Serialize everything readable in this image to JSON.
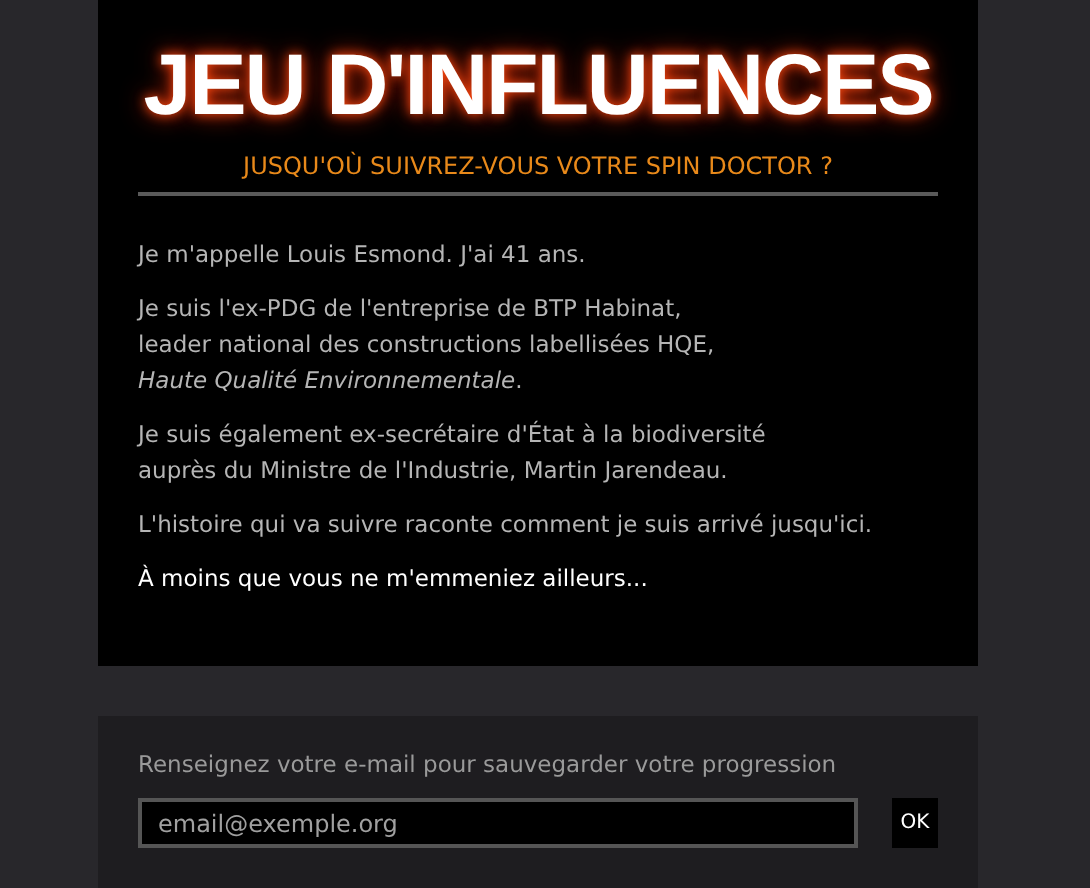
{
  "header": {
    "title": "JEU D'INFLUENCES",
    "subtitle": "JUSQU'OÙ SUIVREZ-VOUS VOTRE SPIN DOCTOR ?"
  },
  "paragraphs": [
    {
      "text": "Je m'appelle Louis Esmond. J'ai 41 ans.",
      "kind": "normal"
    },
    {
      "text": "Je suis l'ex-PDG de l'entreprise de BTP Habinat,\nleader national des constructions labellisées HQE,\n*Haute Qualité Environnementale*.",
      "kind": "normal"
    },
    {
      "text": "Je suis également ex-secrétaire d'État à la biodiversité\nauprès du Ministre de l'Industrie, Martin Jarendeau.",
      "kind": "normal"
    },
    {
      "text": "L'histoire qui va suivre raconte comment je suis arrivé jusqu'ici.",
      "kind": "normal"
    },
    {
      "text": "À moins que vous ne m'emmeniez ailleurs...",
      "kind": "highlight"
    }
  ],
  "save": {
    "label": "Renseignez votre e-mail pour sauvegarder votre progression",
    "placeholder": "email@exemple.org",
    "button": "OK"
  }
}
